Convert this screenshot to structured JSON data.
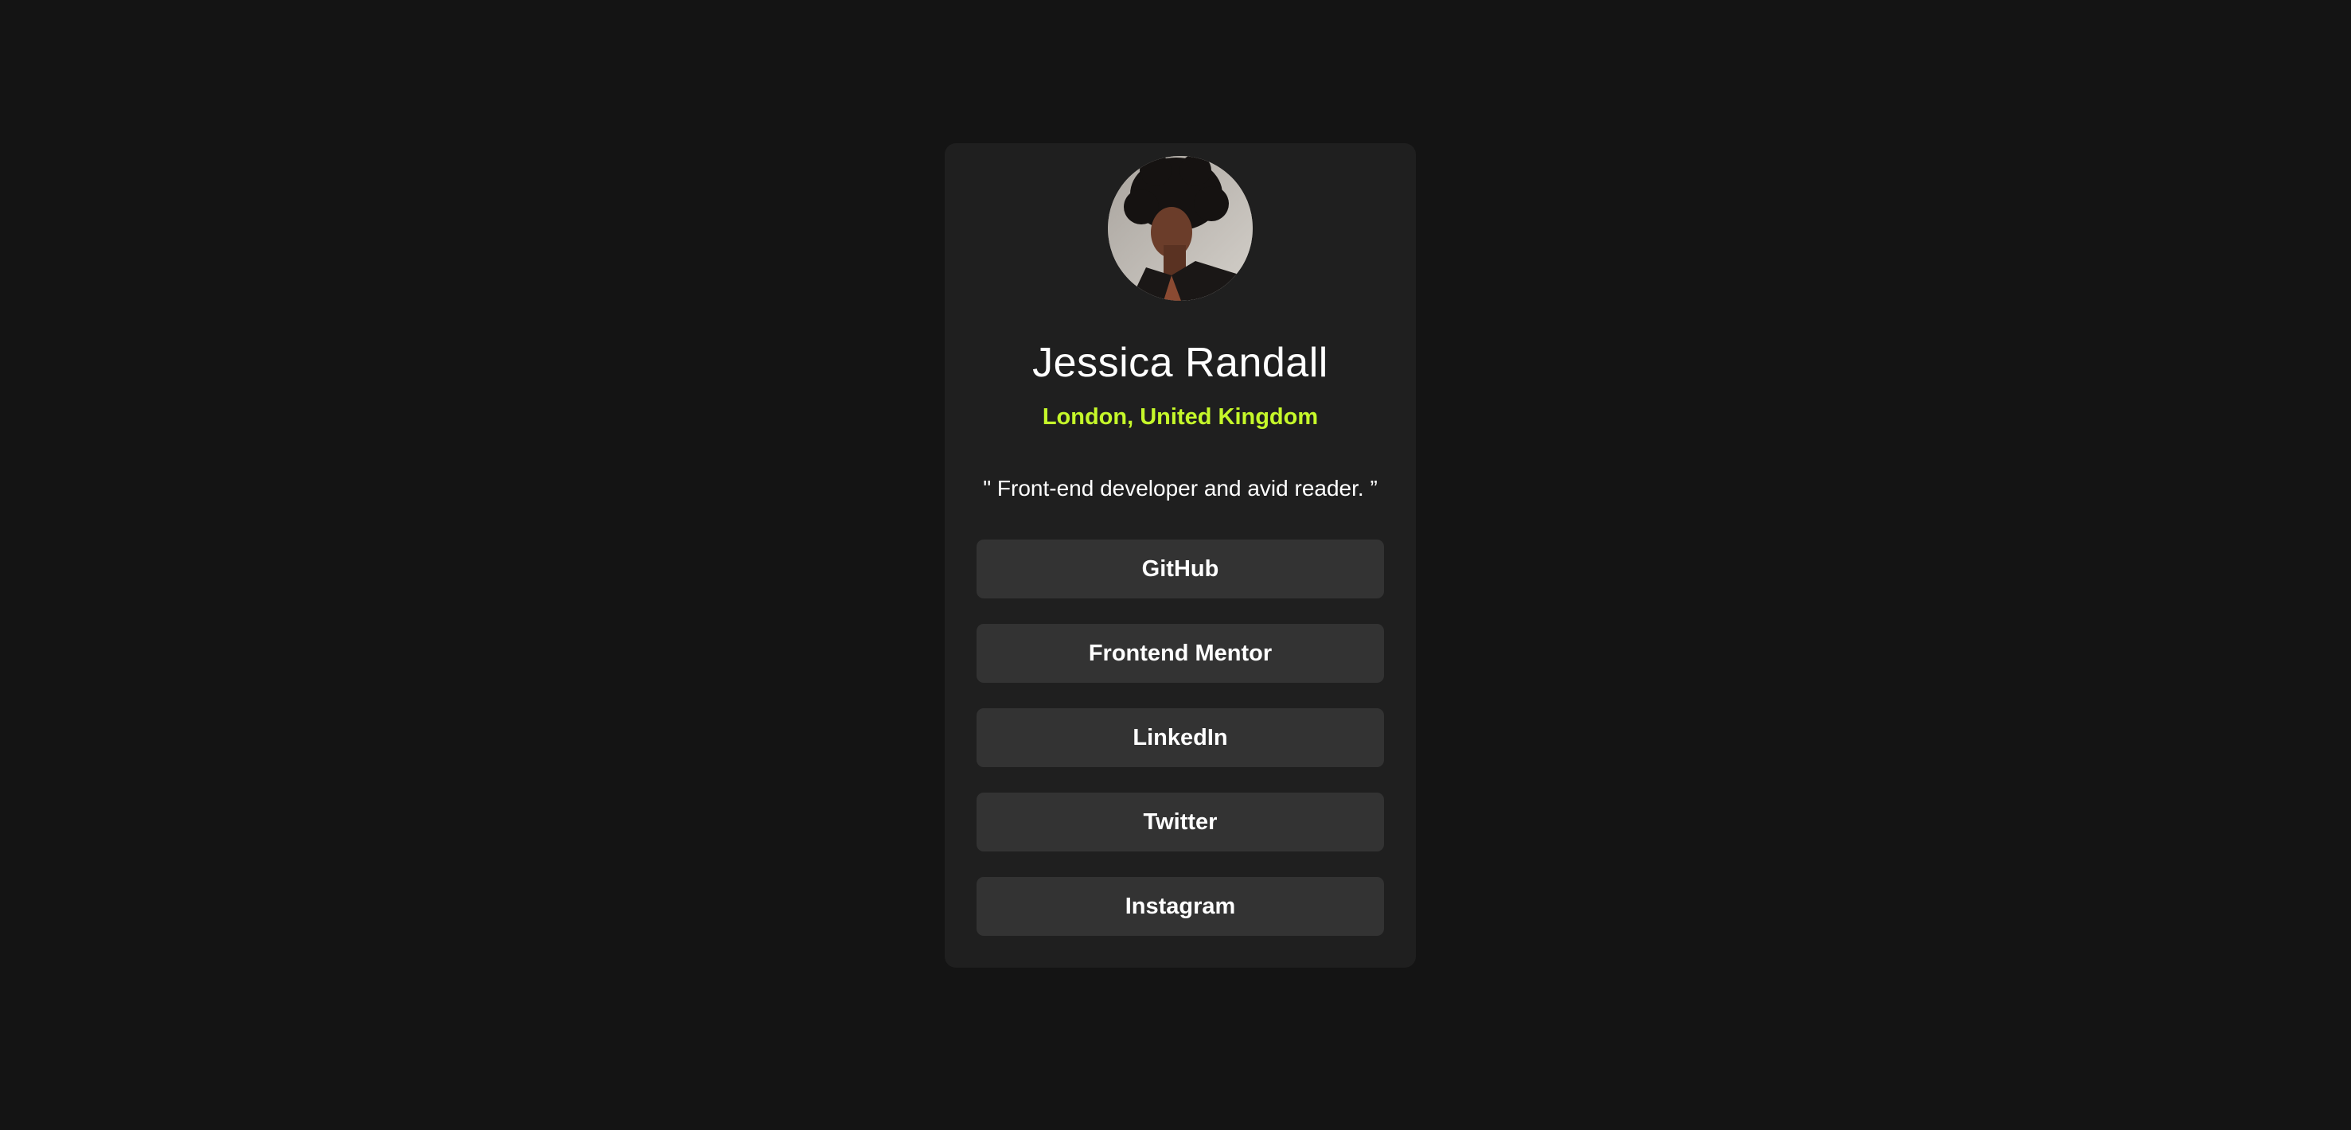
{
  "profile": {
    "name": "Jessica Randall",
    "location": "London, United Kingdom",
    "bio": "\" Front-end developer and avid reader. ”"
  },
  "links": [
    {
      "label": "GitHub"
    },
    {
      "label": "Frontend Mentor"
    },
    {
      "label": "LinkedIn"
    },
    {
      "label": "Twitter"
    },
    {
      "label": "Instagram"
    }
  ],
  "colors": {
    "page_background": "#141414",
    "card_background": "#1f1f1f",
    "button_background": "#333333",
    "accent": "#c5f82a",
    "text": "#ffffff"
  }
}
